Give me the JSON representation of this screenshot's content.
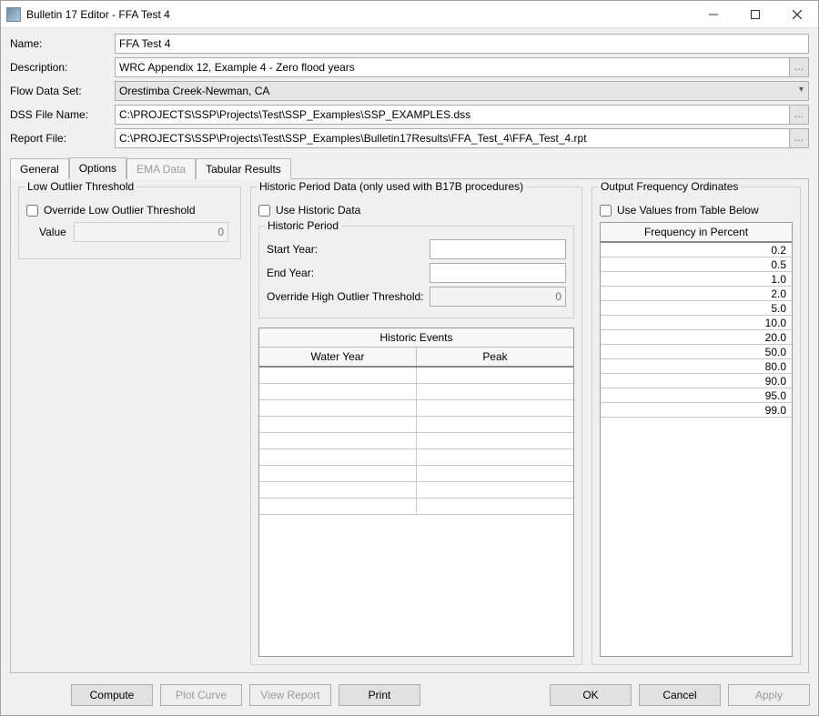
{
  "window_title": "Bulletin 17 Editor - FFA Test 4",
  "fields": {
    "name_label": "Name:",
    "name_value": "FFA Test 4",
    "desc_label": "Description:",
    "desc_value": "WRC Appendix 12, Example 4 - Zero flood years",
    "flow_label": "Flow Data Set:",
    "flow_value": "Orestimba Creek-Newman, CA",
    "dss_label": "DSS File Name:",
    "dss_value": "C:\\PROJECTS\\SSP\\Projects\\Test\\SSP_Examples\\SSP_EXAMPLES.dss",
    "report_label": "Report File:",
    "report_value": "C:\\PROJECTS\\SSP\\Projects\\Test\\SSP_Examples\\Bulletin17Results\\FFA_Test_4\\FFA_Test_4.rpt"
  },
  "tabs": {
    "general": "General",
    "options": "Options",
    "ema": "EMA Data",
    "tabular": "Tabular Results"
  },
  "low_outlier": {
    "group_title": "Low Outlier Threshold",
    "override_label": "Override Low Outlier Threshold",
    "value_label": "Value",
    "value": "0"
  },
  "historic": {
    "group_title": "Historic Period Data (only used with B17B procedures)",
    "use_label": "Use Historic Data",
    "period_title": "Historic Period",
    "start_label": "Start Year:",
    "start_value": "",
    "end_label": "End Year:",
    "end_value": "",
    "override_label": "Override High Outlier Threshold:",
    "override_value": "0",
    "events_title": "Historic Events",
    "col_year": "Water Year",
    "col_peak": "Peak"
  },
  "frequency": {
    "group_title": "Output Frequency Ordinates",
    "use_label": "Use Values from Table Below",
    "col_header": "Frequency in Percent",
    "values": [
      "0.2",
      "0.5",
      "1.0",
      "2.0",
      "5.0",
      "10.0",
      "20.0",
      "50.0",
      "80.0",
      "90.0",
      "95.0",
      "99.0"
    ]
  },
  "buttons": {
    "compute": "Compute",
    "plot": "Plot Curve",
    "view": "View Report",
    "print": "Print",
    "ok": "OK",
    "cancel": "Cancel",
    "apply": "Apply"
  },
  "glyphs": {
    "ellipsis": "…"
  }
}
